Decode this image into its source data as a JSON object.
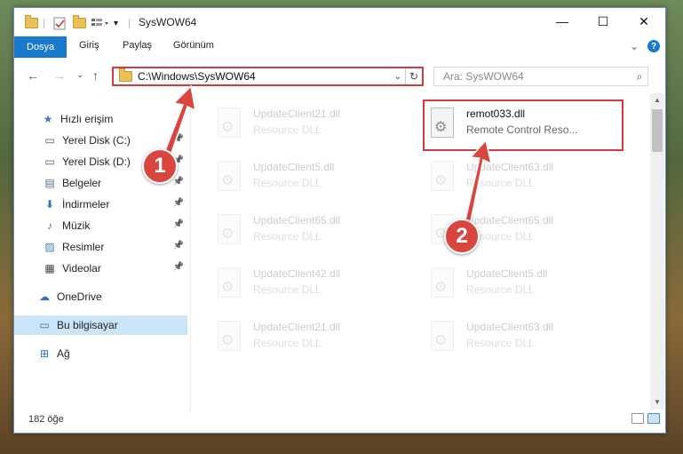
{
  "window": {
    "title": "SysWOW64",
    "minimize": "—",
    "maximize": "☐",
    "close": "✕"
  },
  "ribbon": {
    "tabs": [
      "Dosya",
      "Giriş",
      "Paylaş",
      "Görünüm"
    ],
    "expand": "⌄",
    "help": "?"
  },
  "nav": {
    "back": "←",
    "forward": "→",
    "recent": "⌄",
    "up": "↑",
    "address": "C:\\Windows\\SysWOW64",
    "address_dropdown": "⌄",
    "refresh": "↻",
    "search_placeholder": "Ara: SysWOW64",
    "search_icon": "⌕"
  },
  "sidebar": {
    "items": [
      {
        "label": "Hızlı erişim",
        "icon": "star-icon",
        "glyph": "★",
        "color": "#3a79c6",
        "pinned": false
      },
      {
        "label": "Yerel Disk (C:)",
        "icon": "drive-icon",
        "glyph": "▭",
        "color": "#555555",
        "pinned": true
      },
      {
        "label": "Yerel Disk (D:)",
        "icon": "drive-icon",
        "glyph": "▭",
        "color": "#555555",
        "pinned": true
      },
      {
        "label": "Belgeler",
        "icon": "documents-icon",
        "glyph": "▤",
        "color": "#5a6f8a",
        "pinned": true
      },
      {
        "label": "İndirmeler",
        "icon": "download-icon",
        "glyph": "⬇",
        "color": "#2a72c2",
        "pinned": true
      },
      {
        "label": "Müzik",
        "icon": "music-icon",
        "glyph": "♪",
        "color": "#2a72c2",
        "pinned": true
      },
      {
        "label": "Resimler",
        "icon": "pictures-icon",
        "glyph": "▨",
        "color": "#4a7fb0",
        "pinned": true
      },
      {
        "label": "Videolar",
        "icon": "video-icon",
        "glyph": "▦",
        "color": "#444444",
        "pinned": true
      },
      {
        "label": "OneDrive",
        "icon": "cloud-icon",
        "glyph": "☁",
        "color": "#2a72c2",
        "pinned": false
      },
      {
        "label": "Bu bilgisayar",
        "icon": "computer-icon",
        "glyph": "▭",
        "color": "#2a72c2",
        "pinned": false,
        "selected": true
      },
      {
        "label": "Ağ",
        "icon": "network-icon",
        "glyph": "⊞",
        "color": "#2a72c2",
        "pinned": false
      }
    ],
    "pin_glyph": "📌"
  },
  "files": [
    {
      "name": "UpdateClient21.dll",
      "type": "Resource DLL",
      "faded": true
    },
    {
      "name": "remot033.dll",
      "type": "Remote Control Reso...",
      "faded": false
    },
    {
      "name": "UpdateClient5.dll",
      "type": "Resource DLL",
      "faded": true
    },
    {
      "name": "UpdateClient63.dll",
      "type": "Resource DLL",
      "faded": true
    },
    {
      "name": "UpdateClient65.dll",
      "type": "Resource DLL",
      "faded": true
    },
    {
      "name": "UpdateClient65.dll",
      "type": "Resource DLL",
      "faded": true
    },
    {
      "name": "UpdateClient42.dll",
      "type": "Resource DLL",
      "faded": true
    },
    {
      "name": "UpdateClient5.dll",
      "type": "Resource DLL",
      "faded": true
    },
    {
      "name": "UpdateClient21.dll",
      "type": "Resource DLL",
      "faded": true
    },
    {
      "name": "UpdateClient63.dll",
      "type": "Resource DLL",
      "faded": true
    }
  ],
  "status": {
    "count": "182 öğe"
  },
  "annotations": [
    {
      "number": "1"
    },
    {
      "number": "2"
    }
  ],
  "colors": {
    "accent": "#1979ca",
    "highlight": "#d23b3b"
  }
}
